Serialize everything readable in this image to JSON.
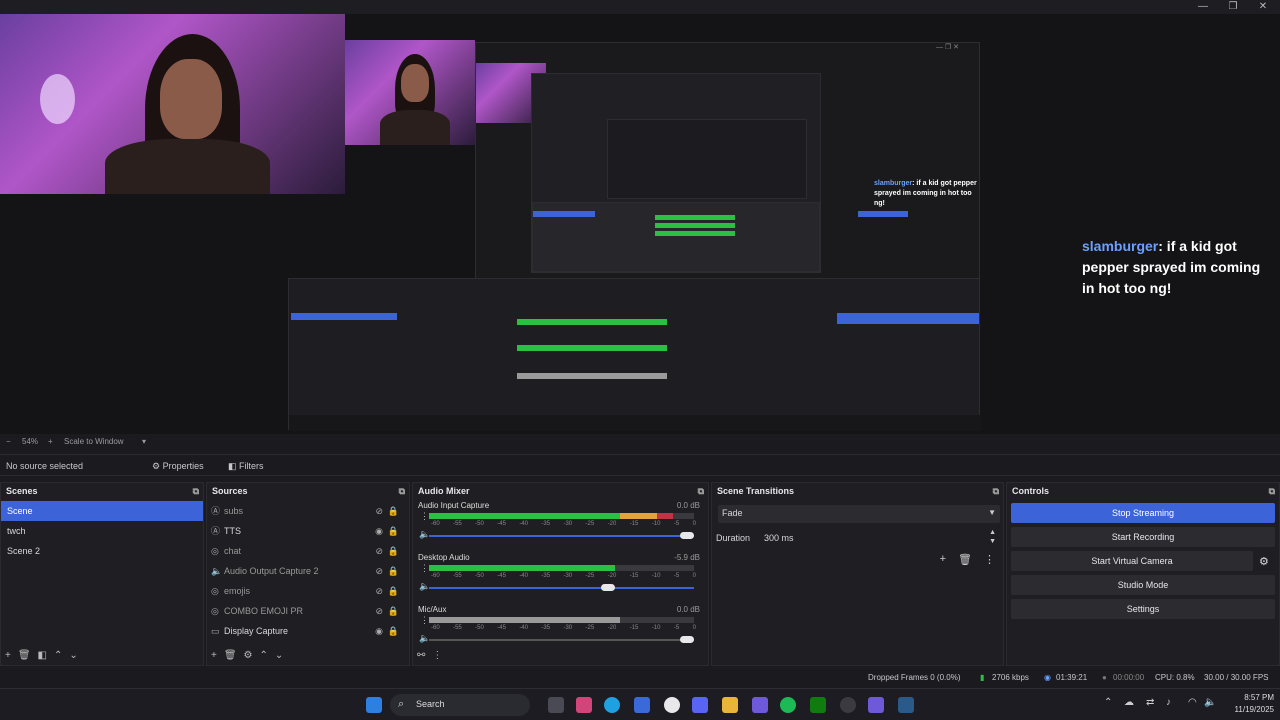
{
  "window": {
    "minimize": "—",
    "maximize": "❐",
    "close": "✕"
  },
  "chat": {
    "outer_user": "slamburger",
    "outer_message": ": if a kid got pepper sprayed im coming in hot too ng!",
    "inner_user": "slamburger",
    "inner_message": ": if a kid got pepper sprayed im coming in hot too ng!"
  },
  "zoom": {
    "value": "54%",
    "mode": "Scale to Window"
  },
  "source_bar": {
    "no_source": "No source selected",
    "properties": "Properties",
    "filters": "Filters"
  },
  "scenes": {
    "title": "Scenes",
    "items": [
      {
        "label": "Scene",
        "selected": true
      },
      {
        "label": "twch",
        "selected": false
      },
      {
        "label": "Scene 2",
        "selected": false
      }
    ]
  },
  "sources": {
    "title": "Sources",
    "items": [
      {
        "label": "subs",
        "icon": "text-icon"
      },
      {
        "label": "TTS",
        "icon": "text-icon"
      },
      {
        "label": "chat",
        "icon": "browser-icon"
      },
      {
        "label": "Audio Output Capture 2",
        "icon": "speaker-icon"
      },
      {
        "label": "emojis",
        "icon": "browser-icon"
      },
      {
        "label": "COMBO EMOJI PR",
        "icon": "browser-icon"
      },
      {
        "label": "Display Capture",
        "icon": "monitor-icon"
      }
    ]
  },
  "mixer": {
    "title": "Audio Mixer",
    "channels": [
      {
        "name": "Audio Input Capture",
        "db": "0.0 dB",
        "level": 0.92,
        "volume": 1.0,
        "muted": false
      },
      {
        "name": "Desktop Audio",
        "db": "-5.9 dB",
        "level": 0.7,
        "volume": 0.7,
        "muted": false
      },
      {
        "name": "Mic/Aux",
        "db": "0.0 dB",
        "level": 0.82,
        "volume": 1.0,
        "muted": true
      }
    ],
    "ticks": [
      "-60",
      "-55",
      "-50",
      "-45",
      "-40",
      "-35",
      "-30",
      "-25",
      "-20",
      "-15",
      "-10",
      "-5",
      "0"
    ]
  },
  "transitions": {
    "title": "Scene Transitions",
    "selected": "Fade",
    "duration_label": "Duration",
    "duration_value": "300 ms"
  },
  "controls": {
    "title": "Controls",
    "stop_streaming": "Stop Streaming",
    "start_recording": "Start Recording",
    "start_virtual_camera": "Start Virtual Camera",
    "studio_mode": "Studio Mode",
    "settings": "Settings"
  },
  "status": {
    "dropped_frames": "Dropped Frames 0 (0.0%)",
    "bitrate": "2706 kbps",
    "live_time": "01:39:21",
    "rec_time": "00:00:00",
    "cpu": "CPU: 0.8%",
    "fps": "30.00 / 30.00 FPS"
  },
  "taskbar": {
    "search": "Search",
    "time": "8:57 PM",
    "date": "11/19/2025"
  },
  "colors": {
    "accent": "#3c64d8",
    "meter_green": "#29c043",
    "meter_yellow": "#e2a43a",
    "meter_red": "#c43344"
  }
}
